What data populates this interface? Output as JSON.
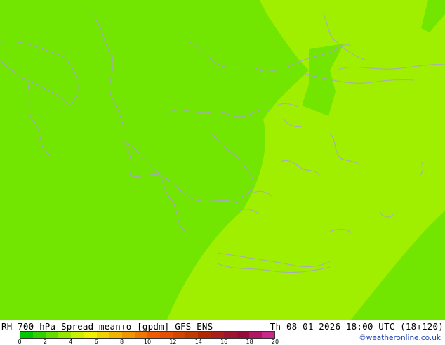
{
  "map": {
    "field_colors": {
      "band_0_2": "#72e600",
      "band_2_4": "#a0ee00",
      "coast": "#a8a8c0"
    }
  },
  "footer": {
    "caption_left": "RH 700 hPa Spread mean+σ [gpdm] GFS ENS",
    "caption_right": "Th 08-01-2026 18:00 UTC (18+120)",
    "credit": "©weatheronline.co.uk",
    "legend": {
      "colors": [
        "#00c800",
        "#32d200",
        "#64dc00",
        "#96e600",
        "#c8f000",
        "#f0f000",
        "#f0d200",
        "#f0b400",
        "#f09600",
        "#f07800",
        "#f05a00",
        "#e65000",
        "#d24600",
        "#be3c00",
        "#b42800",
        "#aa1e1e",
        "#a0142d",
        "#960a3c",
        "#b41464",
        "#c8288c"
      ],
      "ticks": [
        "0",
        "2",
        "4",
        "6",
        "8",
        "10",
        "12",
        "14",
        "16",
        "18",
        "20"
      ]
    }
  }
}
